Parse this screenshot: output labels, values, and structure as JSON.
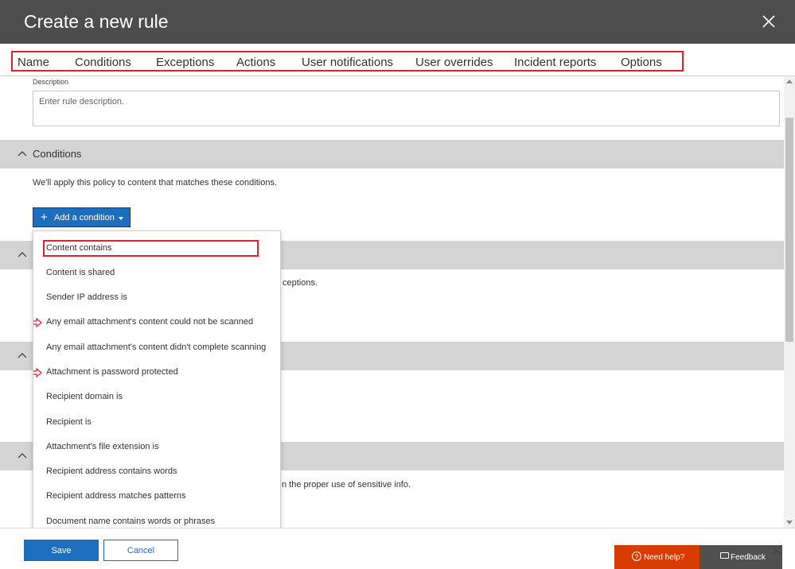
{
  "header": {
    "title": "Create a new rule",
    "close_icon": "close-icon"
  },
  "tabs": [
    {
      "label": "Name"
    },
    {
      "label": "Conditions"
    },
    {
      "label": "Exceptions"
    },
    {
      "label": "Actions"
    },
    {
      "label": "User notifications"
    },
    {
      "label": "User overrides"
    },
    {
      "label": "Incident reports"
    },
    {
      "label": "Options"
    }
  ],
  "description": {
    "label": "Description",
    "placeholder": "Enter rule description."
  },
  "conditions_section": {
    "title": "Conditions",
    "text": "We'll apply this policy to content that matches these conditions.",
    "add_button_label": "Add a condition"
  },
  "exceptions_section": {
    "text_fragment": "ceptions."
  },
  "bottom_section": {
    "text_fragment": "n the proper use of sensitive info."
  },
  "condition_menu": {
    "items": [
      {
        "label": "Content contains"
      },
      {
        "label": "Content is shared"
      },
      {
        "label": "Sender IP address is"
      },
      {
        "label": "Any email attachment's content could not be scanned"
      },
      {
        "label": "Any email attachment's content didn't complete scanning"
      },
      {
        "label": "Attachment is password protected"
      },
      {
        "label": "Recipient domain is"
      },
      {
        "label": "Recipient is"
      },
      {
        "label": "Attachment's file extension is"
      },
      {
        "label": "Recipient address contains words"
      },
      {
        "label": "Recipient address matches patterns"
      },
      {
        "label": "Document name contains words or phrases"
      }
    ]
  },
  "footer": {
    "save_label": "Save",
    "cancel_label": "Cancel",
    "help_label": "Need help?",
    "feedback_label": "Feedback"
  },
  "colors": {
    "header_bg": "#4d4d4d",
    "accent_blue": "#1e6ebe",
    "highlight_red": "#e0202b",
    "help_orange": "#d83b01"
  }
}
